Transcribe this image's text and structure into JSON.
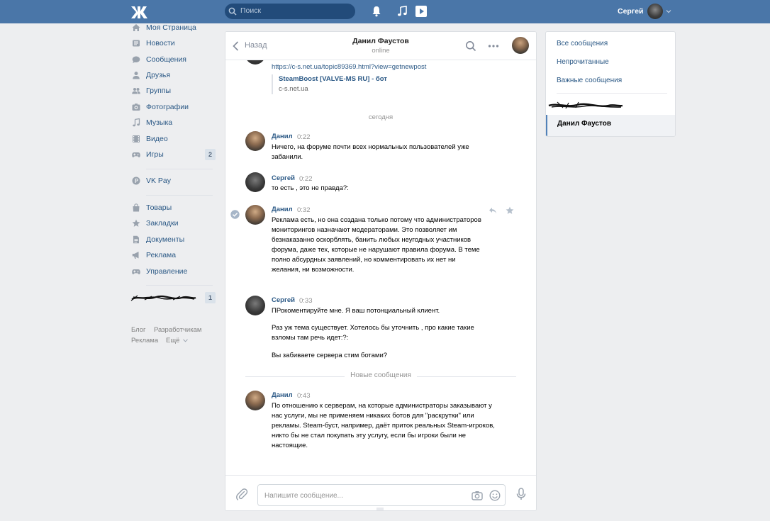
{
  "header": {
    "logo": "vk-logo",
    "search_placeholder": "Поиск",
    "user_name": "Сергей"
  },
  "left_nav": {
    "items": [
      {
        "label": "Моя Страница",
        "icon": "home-icon"
      },
      {
        "label": "Новости",
        "icon": "news-icon"
      },
      {
        "label": "Сообщения",
        "icon": "messages-icon"
      },
      {
        "label": "Друзья",
        "icon": "friends-icon"
      },
      {
        "label": "Группы",
        "icon": "groups-icon"
      },
      {
        "label": "Фотографии",
        "icon": "camera-icon"
      },
      {
        "label": "Музыка",
        "icon": "music-icon"
      },
      {
        "label": "Видео",
        "icon": "video-icon"
      },
      {
        "label": "Игры",
        "icon": "gamepad-icon",
        "badge": "2"
      },
      {
        "label": "VK Pay",
        "icon": "vkpay-icon"
      },
      {
        "label": "Товары",
        "icon": "shopping-bag-icon"
      },
      {
        "label": "Закладки",
        "icon": "star-icon"
      },
      {
        "label": "Документы",
        "icon": "documents-icon"
      },
      {
        "label": "Реклама",
        "icon": "megaphone-icon"
      },
      {
        "label": "Управление",
        "icon": "gamepad-icon"
      }
    ],
    "redacted_item_badge": "1",
    "footer": {
      "blog": "Блог",
      "developers": "Разработчикам",
      "ads": "Реклама",
      "more": "Ещё"
    }
  },
  "chat": {
    "back_label": "Назад",
    "peer_name": "Данил Фаустов",
    "peer_status": "online",
    "attachment": {
      "url": "https://c-s.net.ua/topic89369.html?view=getnewpost",
      "title": "SteamBoost [VALVE-MS RU] - бот",
      "domain": "c-s.net.ua"
    },
    "day_separator": "сегодня",
    "messages": [
      {
        "author": "Данил",
        "time": "0:22",
        "text": "Ничего, на форуме почти всех нормальных пользователей уже забанили."
      },
      {
        "author": "Сергей",
        "time": "0:22",
        "text": "то есть , это не правда?:"
      },
      {
        "author": "Данил",
        "time": "0:32",
        "text": "Реклама есть, но она создана только потому что администраторов мониторингов назначают модераторами. Это позволяет им безнаказанно оскорблять, банить любых неугодных участников форума, даже тех, которые не нарушают правила форума. В теме полно абсурдных заявлений, но комментировать их нет ни желания, ни возможности."
      },
      {
        "author": "Сергей",
        "time": "0:33",
        "text1": "ПРокоментируйте мне. Я ваш потонциальный клиент.",
        "text2": "Раз уж тема существует. Хотелось бы уточнить , про какие такие взломы там речь идет:?:",
        "text3": "Вы забиваете сервера стим ботами?"
      },
      {
        "author": "Данил",
        "time": "0:43",
        "text": "По отношению к серверам, на которые администраторы заказывают у нас услуги, мы не применяем никаких ботов для \"раскрутки\" или рекламы. Steam-буст, например, даёт приток реальных Steam-игроков, никто бы не стал покупать эту услугу, если бы игроки были не настоящие."
      }
    ],
    "new_messages_label": "Новые сообщения",
    "compose_placeholder": "Напишите сообщение..."
  },
  "right_panel": {
    "all": "Все сообщения",
    "unread": "Непрочитанные",
    "important": "Важные сообщения",
    "active_chat": "Данил Фаустов"
  },
  "colors": {
    "header_bg": "#4a76a8",
    "link": "#2a5885",
    "page_bg": "#edeef0",
    "active_accent": "#5181b8"
  }
}
